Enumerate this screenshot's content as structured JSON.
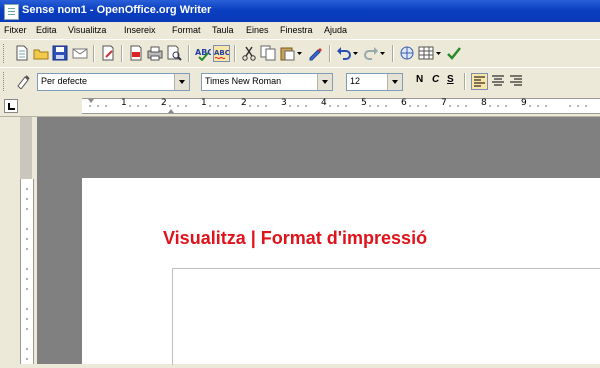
{
  "window": {
    "title": "Sense nom1 - OpenOffice.org Writer"
  },
  "menu": [
    "Fitxer",
    "Edita",
    "Visualitza",
    "Insereix",
    "Format",
    "Taula",
    "Eines",
    "Finestra",
    "Ajuda"
  ],
  "formatting": {
    "style_value": "Per defecte",
    "font_value": "Times New Roman",
    "size_value": "12",
    "bold_label": "N",
    "italic_label": "C",
    "underline_label": "S"
  },
  "ruler": {
    "labels": [
      "1",
      "2",
      "1",
      "2",
      "3",
      "4",
      "5",
      "6",
      "7",
      "8",
      "9"
    ]
  },
  "document": {
    "heading": "Visualitza | Format d'impressió"
  },
  "colors": {
    "heading": "#e0131b",
    "titlebar": "#0a3fc0",
    "workspace": "#808080"
  }
}
